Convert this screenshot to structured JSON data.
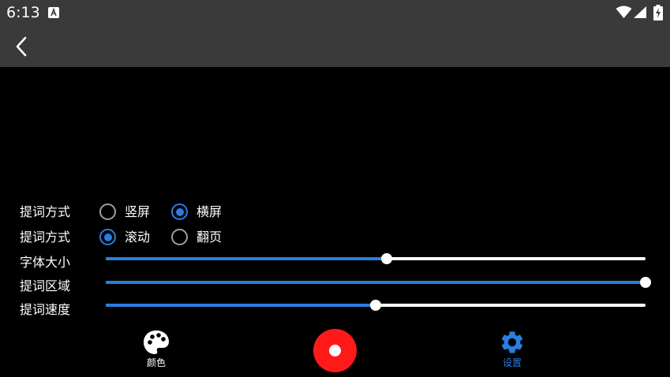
{
  "status_bar": {
    "time": "6:13"
  },
  "settings": {
    "orientation_label": "提词方式",
    "orientation_options": [
      {
        "label": "竖屏",
        "checked": false
      },
      {
        "label": "横屏",
        "checked": true
      }
    ],
    "mode_label": "提词方式",
    "mode_options": [
      {
        "label": "滚动",
        "checked": true
      },
      {
        "label": "翻页",
        "checked": false
      }
    ],
    "font_size_label": "字体大小",
    "font_size_value": 0.52,
    "area_label": "提词区域",
    "area_value": 1.0,
    "speed_label": "提词速度",
    "speed_value": 0.5
  },
  "bottom_nav": {
    "color_label": "颜色",
    "settings_label": "设置"
  },
  "colors": {
    "accent": "#2a7de1",
    "record": "#ff1a1a",
    "bar_bg": "#3a3a3a"
  }
}
